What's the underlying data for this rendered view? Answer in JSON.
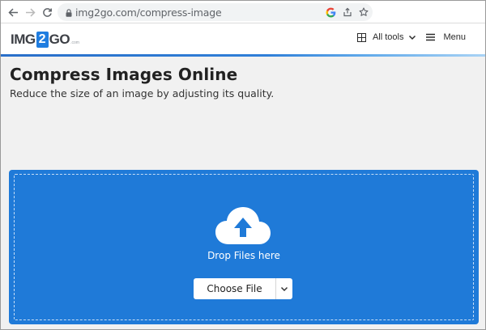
{
  "browser": {
    "url": "img2go.com/compress-image",
    "icons": [
      "back-arrow-icon",
      "forward-arrow-icon",
      "reload-icon",
      "lock-icon",
      "google-icon",
      "share-icon",
      "star-icon"
    ]
  },
  "header": {
    "logo_left": "IMG",
    "logo_mid": "2",
    "logo_right": "GO",
    "logo_small": ".com",
    "all_tools_label": "All tools",
    "menu_label": "Menu"
  },
  "main": {
    "title": "Compress Images Online",
    "subtitle": "Reduce the size of an image by adjusting its quality."
  },
  "upload": {
    "drop_label": "Drop Files here",
    "choose_label": "Choose File"
  },
  "colors": {
    "accent": "#1f7ad8",
    "page_bg": "#f1f1f1",
    "header_bg": "#ffffff"
  }
}
